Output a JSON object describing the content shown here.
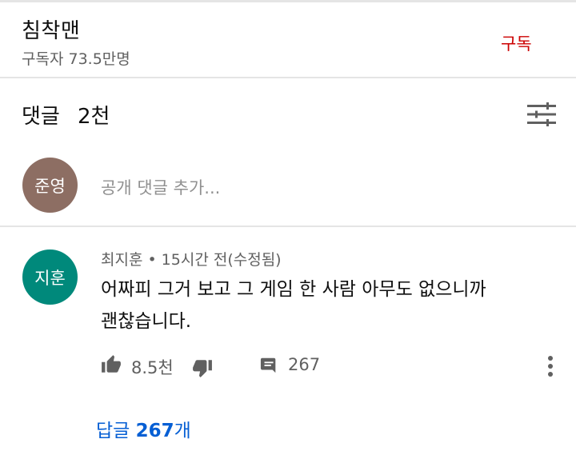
{
  "channel": {
    "name": "침착맨",
    "subscribers": "구독자 73.5만명",
    "subscribe_label": "구독"
  },
  "comments_header": {
    "title": "댓글",
    "count": "2천",
    "sort_icon": "sort-icon"
  },
  "add_comment": {
    "avatar_text": "준영",
    "avatar_color": "#8d6e63",
    "placeholder": "공개 댓글 추가..."
  },
  "comment": {
    "avatar_text": "지훈",
    "avatar_color": "#00897b",
    "author": "최지훈",
    "separator": "•",
    "time": "15시간 전(수정됨)",
    "text_line1": "어짜피 그거 보고 그 게임 한 사람 아무도 없으니까",
    "text_line2": "괜찮습니다.",
    "likes": "8.5천",
    "replies": "267",
    "view_replies_prefix": "답글",
    "view_replies_count": "267",
    "view_replies_suffix": "개"
  },
  "colors": {
    "subscribe": "#cc0000",
    "link": "#065fd4",
    "secondary_text": "#606060"
  }
}
